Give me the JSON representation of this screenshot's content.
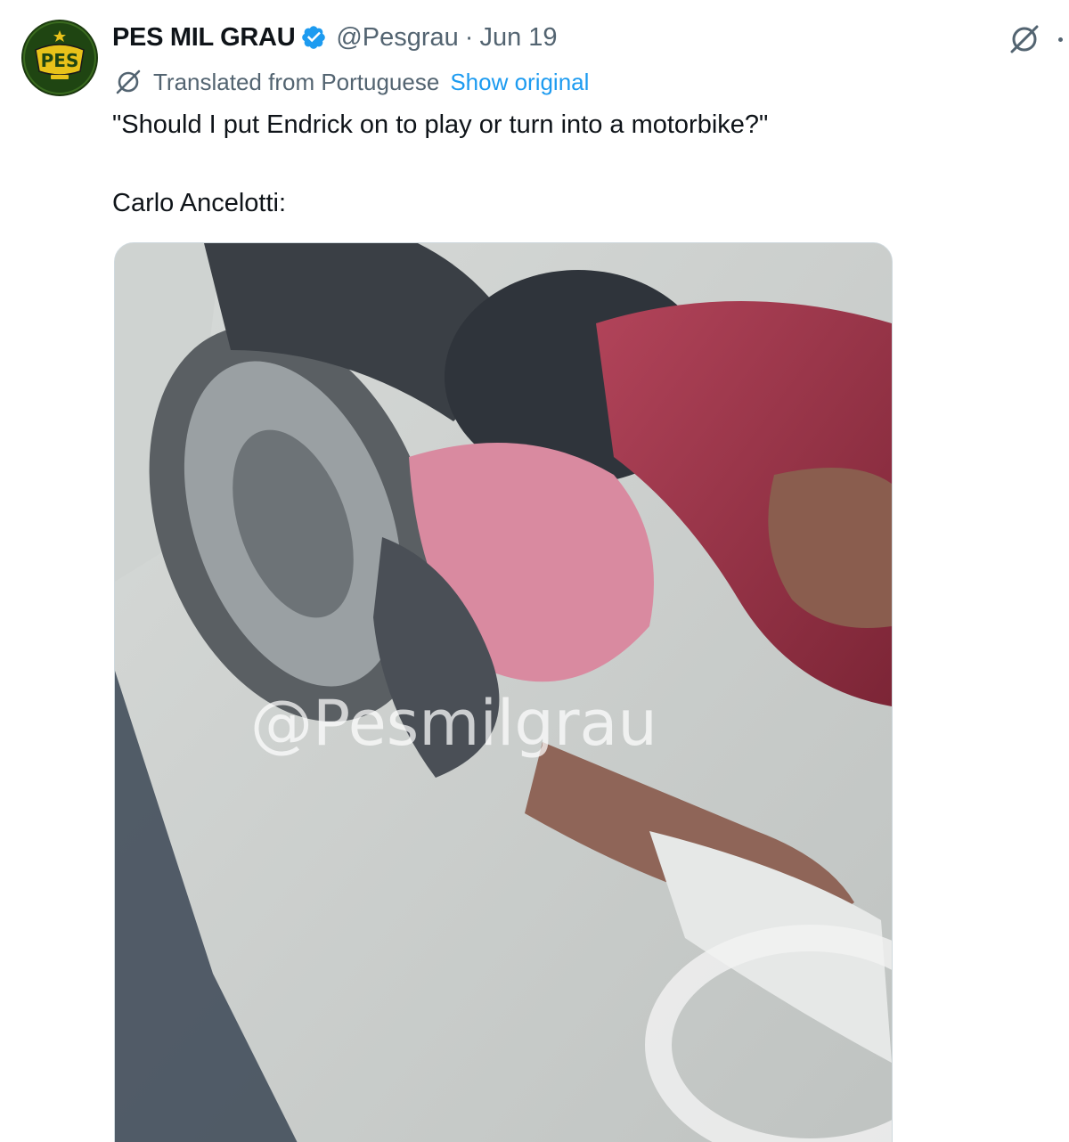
{
  "tweet": {
    "author": {
      "display_name": "PES MIL GRAU",
      "handle": "@Pesgrau",
      "verified": true,
      "avatar_text": "PES"
    },
    "separator": "·",
    "date": "Jun 19",
    "translation": {
      "label": "Translated from Portuguese",
      "show_original": "Show original"
    },
    "text": "\"Should I put Endrick on to play or turn into a motorbike?\"\n\nCarlo Ancelotti:",
    "media": {
      "watermark": "@Pesmilgrau"
    }
  },
  "icons": {
    "verified": "verified-badge-icon",
    "grok": "grok-icon",
    "translate": "grok-translate-icon",
    "more": "more-icon"
  },
  "colors": {
    "accent": "#1d9bf0",
    "secondary_text": "#536471",
    "primary_text": "#0f1419"
  }
}
